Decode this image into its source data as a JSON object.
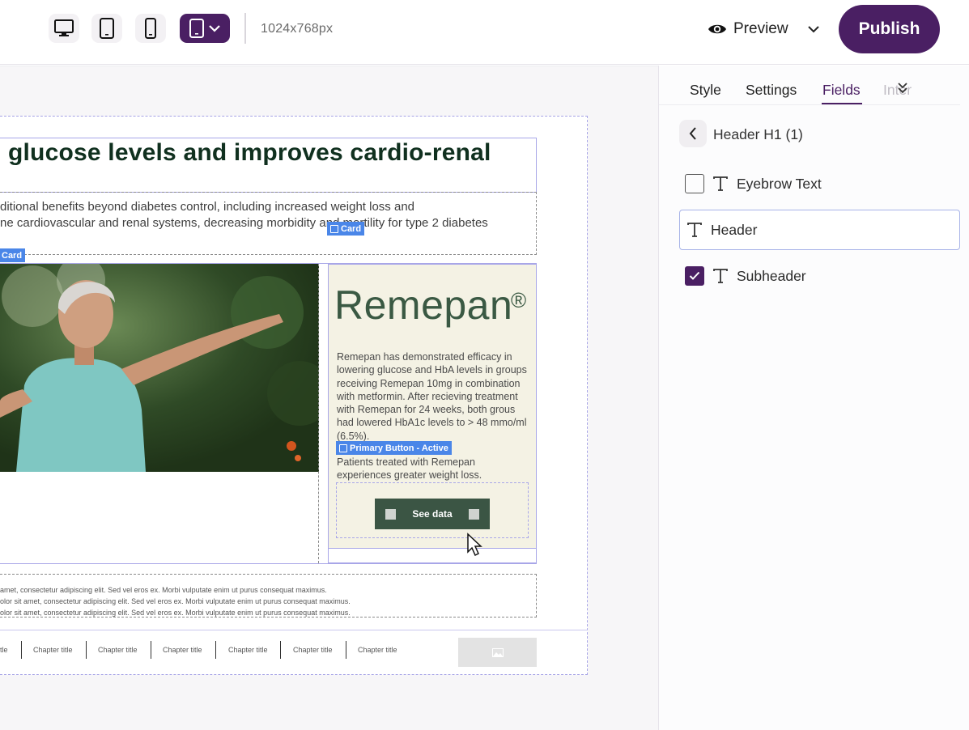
{
  "toolbar": {
    "devices": [
      {
        "name": "desktop",
        "icon": "desktop-icon"
      },
      {
        "name": "tablet",
        "icon": "tablet-icon"
      },
      {
        "name": "mobile",
        "icon": "mobile-icon"
      },
      {
        "name": "custom-tablet",
        "icon": "tablet-dropdown-icon",
        "selected": true
      }
    ],
    "resolution": "1024x768px",
    "preview_label": "Preview",
    "publish_label": "Publish",
    "accent_color": "#4a1f63"
  },
  "canvas": {
    "heading": "glucose levels and improves cardio-renal",
    "subheading": "ditional benefits beyond diabetes control, including increased weight loss and\nne cardiovascular and renal systems, decreasing morbidity and mortility for type 2 diabetes",
    "tag_card_top": "Card",
    "tag_card_left": "Card",
    "brand_name": "Remepan",
    "brand_mark": "®",
    "body_text": "Remepan has demonstrated efficacy in lowering glucose and HbA levels in groups receiving Remepan 10mg in combination with metformin.  After recieving treatment with Remepan for 24 weeks, both grous had lowered HbA1c levels to > 48 mmo/ml (6.5%).",
    "tag_button": "Primary Button - Active",
    "body_text_2": "Patients treated with Remepan experiences greater weight loss.",
    "cta_label": "See data",
    "footer_lines": [
      "amet, consectetur adipiscing elit. Sed vel eros ex. Morbi vulputate enim ut purus consequat maximus.",
      "olor sit amet, consectetur adipiscing elit. Sed vel eros ex. Morbi vulputate enim ut purus consequat maximus.",
      "olor sit amet, consectetur adipiscing elit. Sed vel eros ex. Morbi vulputate enim ut purus consequat maximus."
    ],
    "nav_first": "tle",
    "nav_items": [
      "Chapter title",
      "Chapter title",
      "Chapter title",
      "Chapter title",
      "Chapter title",
      "Chapter title"
    ]
  },
  "panel": {
    "tabs": [
      "Style",
      "Settings",
      "Fields",
      "Inter"
    ],
    "active_tab": "Fields",
    "title": "Header H1 (1)",
    "fields": [
      {
        "label": "Eyebrow Text",
        "checked": false
      },
      {
        "label": "Header",
        "checked": null
      },
      {
        "label": "Subheader",
        "checked": true
      }
    ]
  }
}
